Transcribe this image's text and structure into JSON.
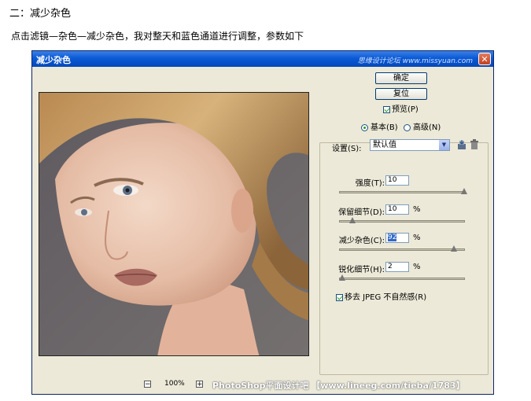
{
  "article": {
    "heading": "二：减少杂色",
    "intro": "点击滤镜—杂色—减少杂色，我对整天和蓝色通道进行调整，参数如下"
  },
  "dialog": {
    "title": "减少杂色",
    "title_watermark": "思缘设计论坛 www.missyuan.com",
    "close_symbol": "✕",
    "ok_label": "确定",
    "reset_label": "复位",
    "preview_label": "预览(P)",
    "preview_checked": true,
    "mode_basic_label": "基本(B)",
    "mode_advanced_label": "高级(N)",
    "mode_selected": "basic",
    "settings_label": "设置(S):",
    "settings_value": "默认值",
    "icons": [
      "save-settings-icon",
      "delete-settings-icon"
    ],
    "sliders": [
      {
        "label": "强度(T):",
        "value": "10",
        "unit": "",
        "fraction": 1.0
      },
      {
        "label": "保留细节(D):",
        "value": "10",
        "unit": "%",
        "fraction": 0.1
      },
      {
        "label": "减少杂色(C):",
        "value": "92",
        "unit": "%",
        "fraction": 0.92
      },
      {
        "label": "锐化细节(H):",
        "value": "2",
        "unit": "%",
        "fraction": 0.02
      }
    ],
    "jpeg_label": "移去 JPEG 不自然感(R)",
    "jpeg_checked": true,
    "zoom_minus": "−",
    "zoom_plus": "+",
    "zoom_value": "100%"
  },
  "footer_watermark": "PhotoShop平面设计吧 【www.lineeg.com/tieba/1783】",
  "colors": {
    "titlebar": "#0a5ad6",
    "dialog_bg": "#ece9d8",
    "selection": "#316ac5"
  }
}
